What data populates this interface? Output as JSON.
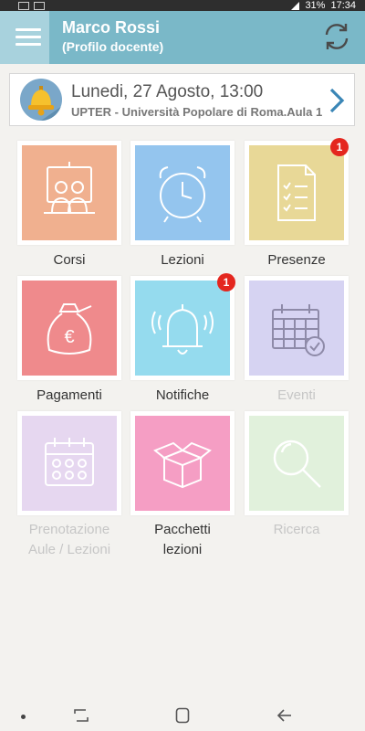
{
  "status_bar": {
    "battery": "31%",
    "time": "17:34"
  },
  "header": {
    "name": "Marco Rossi",
    "profile": "(Profilo docente)"
  },
  "event": {
    "date": "Lunedi, 27 Agosto, 13:00",
    "place": "UPTER - Università Popolare di Roma.Aula 1"
  },
  "tiles": [
    {
      "label": "Corsi",
      "icon": "teachers-board-icon",
      "color": "#f0b08f",
      "active": true
    },
    {
      "label": "Lezioni",
      "icon": "alarm-clock-icon",
      "color": "#94c5ee",
      "active": true
    },
    {
      "label": "Presenze",
      "icon": "checklist-icon",
      "color": "#e8d897",
      "active": true,
      "badge": "1"
    },
    {
      "label": "Pagamenti",
      "icon": "money-bag-icon",
      "color": "#ef8a8c",
      "active": true
    },
    {
      "label": "Notifiche",
      "icon": "bell-icon",
      "color": "#95dbee",
      "active": true,
      "badge": "1"
    },
    {
      "label": "Eventi",
      "icon": "calendar-check-icon",
      "color": "#d6d3f2",
      "active": false
    },
    {
      "label": "Prenotazione Aule / Lezioni",
      "label_line1": "Prenotazione",
      "label_line2": "Aule / Lezioni",
      "icon": "calendar-grid-icon",
      "color": "#e6d7f0",
      "active": false
    },
    {
      "label": "Pacchetti lezioni",
      "label_line1": "Pacchetti",
      "label_line2": "lezioni",
      "icon": "open-box-icon",
      "color": "#f59ec4",
      "active": true
    },
    {
      "label": "Ricerca",
      "icon": "magnifier-icon",
      "color": "#e1f1dc",
      "active": false
    }
  ]
}
